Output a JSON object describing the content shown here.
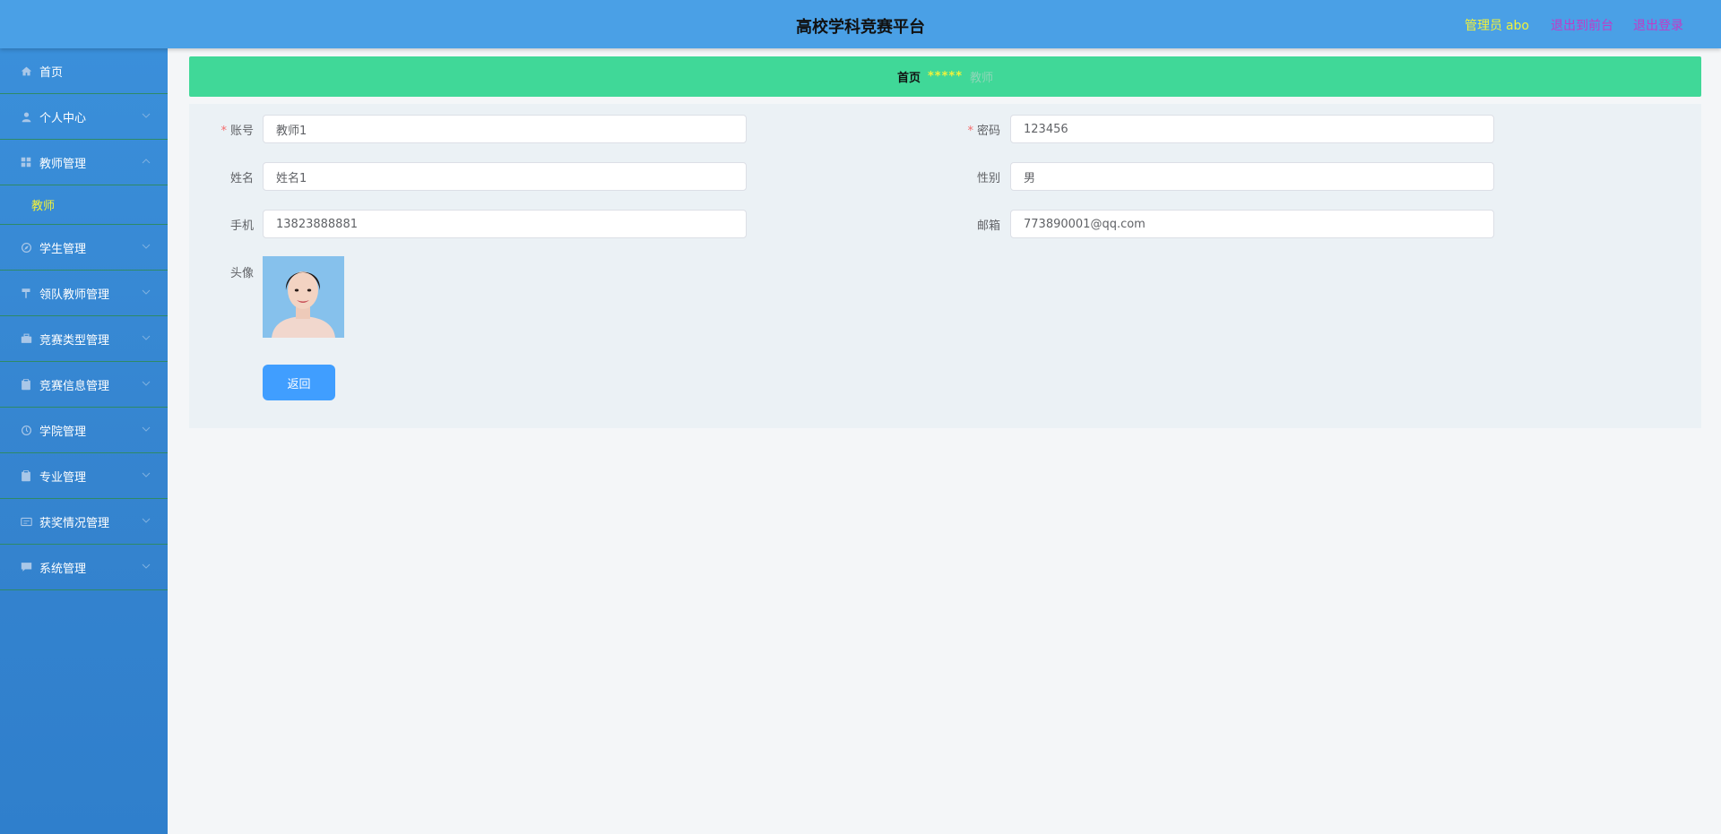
{
  "header": {
    "title": "高校学科竞赛平台",
    "role_label": "管理员",
    "username": "abo",
    "back_to_front": "退出到前台",
    "logout": "退出登录"
  },
  "sidebar": {
    "items": [
      {
        "label": "首页",
        "icon": "home-icon"
      },
      {
        "label": "个人中心",
        "icon": "user-icon"
      },
      {
        "label": "教师管理",
        "icon": "grid-icon",
        "expanded": true,
        "children": [
          {
            "label": "教师"
          }
        ]
      },
      {
        "label": "学生管理",
        "icon": "compass-icon"
      },
      {
        "label": "领队教师管理",
        "icon": "flag-icon"
      },
      {
        "label": "竞赛类型管理",
        "icon": "briefcase-icon"
      },
      {
        "label": "竞赛信息管理",
        "icon": "clipboard-icon"
      },
      {
        "label": "学院管理",
        "icon": "circle-icon"
      },
      {
        "label": "专业管理",
        "icon": "clipboard-icon"
      },
      {
        "label": "获奖情况管理",
        "icon": "ticket-icon"
      },
      {
        "label": "系统管理",
        "icon": "chat-icon"
      }
    ]
  },
  "breadcrumb": {
    "home": "首页",
    "separator": "*****",
    "current": "教师"
  },
  "form": {
    "account": {
      "label": "账号",
      "value": "教师1"
    },
    "password": {
      "label": "密码",
      "value": "123456"
    },
    "name": {
      "label": "姓名",
      "value": "姓名1"
    },
    "gender": {
      "label": "性别",
      "value": "男"
    },
    "phone": {
      "label": "手机",
      "value": "13823888881"
    },
    "email": {
      "label": "邮箱",
      "value": "773890001@qq.com"
    },
    "avatar": {
      "label": "头像"
    },
    "back_button": "返回",
    "required_mark": "*"
  },
  "colors": {
    "header_bg": "#4aa0e6",
    "sidebar_bg": "#3584cf",
    "breadcrumb_bg": "#40d898",
    "accent_yellow": "#f2f23a",
    "link_magenta": "#c03bc8",
    "button_primary": "#409eff"
  }
}
